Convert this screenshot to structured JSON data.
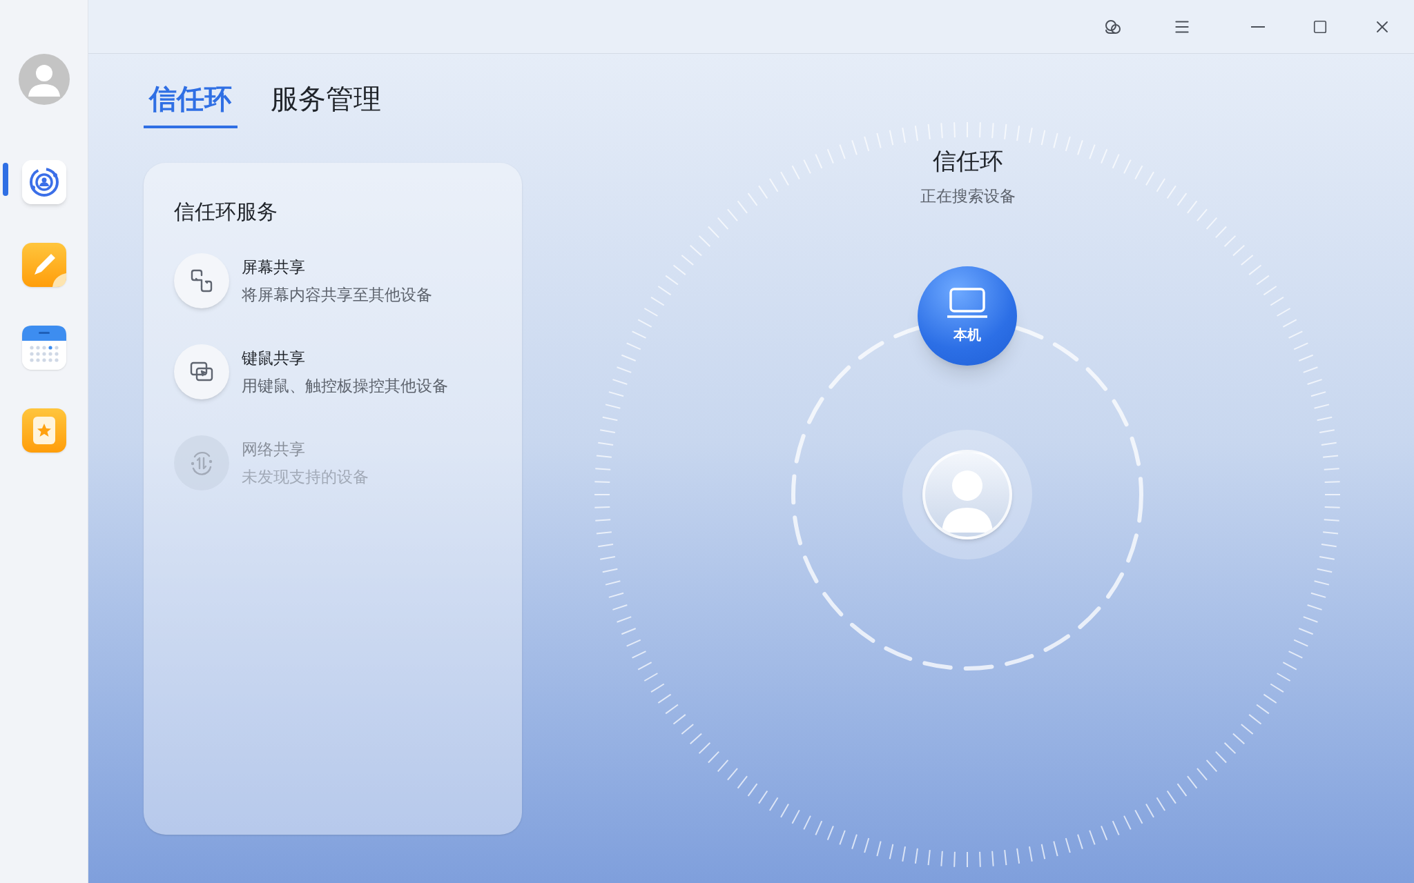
{
  "sidebar": {
    "items": [
      {
        "kind": "radar",
        "selected": true
      },
      {
        "kind": "notes",
        "selected": false
      },
      {
        "kind": "calendar",
        "selected": false
      },
      {
        "kind": "favorites",
        "selected": false
      }
    ]
  },
  "tabs": [
    {
      "label": "信任环",
      "selected": true
    },
    {
      "label": "服务管理",
      "selected": false
    }
  ],
  "services_panel": {
    "title": "信任环服务",
    "items": [
      {
        "kind": "screen",
        "title": "屏幕共享",
        "description": "将屏幕内容共享至其他设备",
        "disabled": false
      },
      {
        "kind": "keyboard_mouse",
        "title": "键鼠共享",
        "description": "用键鼠、触控板操控其他设备",
        "disabled": false
      },
      {
        "kind": "network",
        "title": "网络共享",
        "description": "未发现支持的设备",
        "disabled": true
      }
    ]
  },
  "trust_ring": {
    "title": "信任环",
    "status": "正在搜索设备",
    "local_device": {
      "label": "本机"
    }
  }
}
